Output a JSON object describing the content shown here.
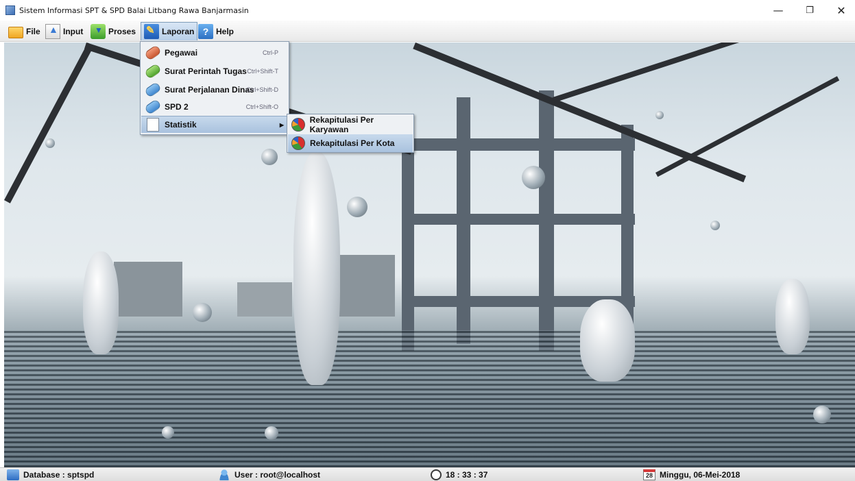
{
  "window": {
    "title": "Sistem Informasi SPT & SPD Balai Litbang Rawa Banjarmasin",
    "controls": [
      "minimize-icon",
      "maximize-icon",
      "close-icon"
    ]
  },
  "menubar": {
    "items": [
      {
        "label": "File",
        "icon": "folder-icon"
      },
      {
        "label": "Input",
        "icon": "upload-icon"
      },
      {
        "label": "Proses",
        "icon": "process-icon"
      },
      {
        "label": "Laporan",
        "icon": "report-icon"
      },
      {
        "label": "Help",
        "icon": "help-icon"
      }
    ],
    "open_menu": "Laporan"
  },
  "laporan_menu": {
    "items": [
      {
        "label": "Pegawai",
        "shortcut": "Ctrl-P",
        "icon": "pill-red-icon"
      },
      {
        "label": "Surat Perintah Tugas",
        "shortcut": "Ctrl+Shift-T",
        "icon": "pill-green-icon"
      },
      {
        "label": "Surat Perjalanan Dinas",
        "shortcut": "Ctrl+Shift-D",
        "icon": "pill-blue-icon"
      },
      {
        "label": "SPD 2",
        "shortcut": "Ctrl+Shift-O",
        "icon": "pill-blue-icon"
      },
      {
        "label": "Statistik",
        "shortcut": "",
        "icon": "document-icon"
      }
    ]
  },
  "statistik_submenu": {
    "items": [
      {
        "label": "Rekapitulasi Per Karyawan",
        "icon": "pie-chart-icon"
      },
      {
        "label": "Rekapitulasi Per Kota",
        "icon": "pie-chart-icon"
      }
    ],
    "highlighted": "Rekapitulasi Per Kota"
  },
  "statusbar": {
    "database": "Database : sptspd",
    "user": "User : root@localhost",
    "time": "18 : 33 : 37",
    "date": "Minggu, 06-Mei-2018",
    "calendar_day": "28"
  },
  "colors": {
    "menu_highlight": "#b8cfe8",
    "menu_bg": "#eef1f4",
    "statusbar_bg": "#e6e6e6"
  }
}
